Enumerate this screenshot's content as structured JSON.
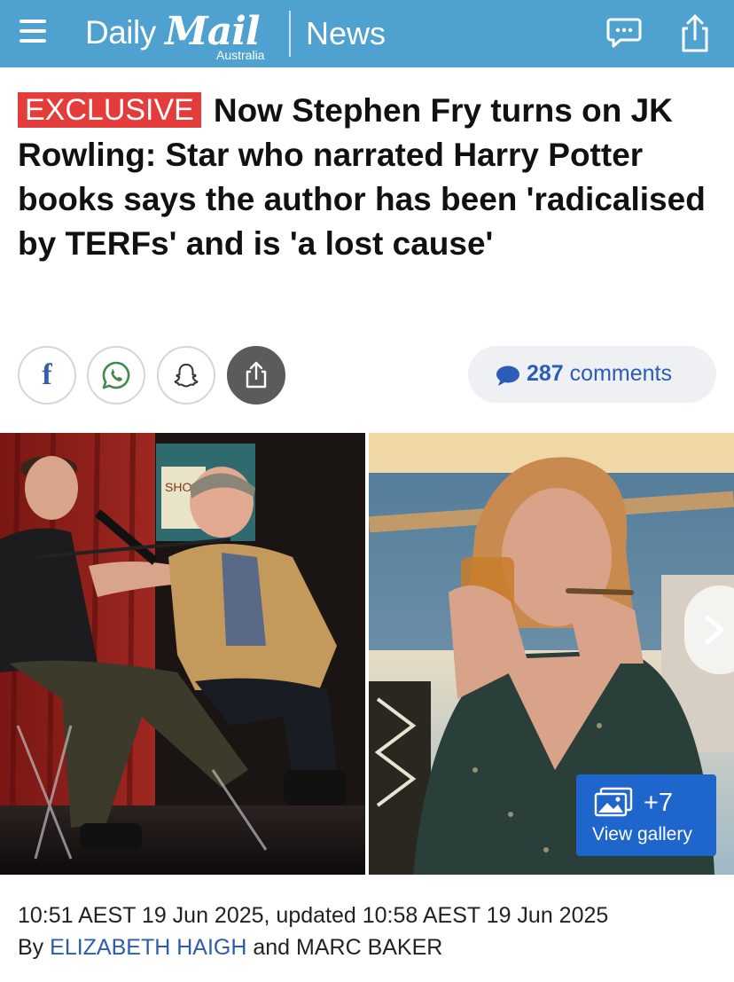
{
  "header": {
    "brand_daily": "Daily",
    "brand_mail": "Mail",
    "brand_sub": "Australia",
    "section": "News",
    "bg_color": "#4fa2cf"
  },
  "article": {
    "badge": "EXCLUSIVE",
    "headline": "Now Stephen Fry turns on JK Rowling: Star who narrated Harry Potter books says the author has been 'radicalised by TERFs' and is 'a lost cause'",
    "badge_color": "#e43b3b"
  },
  "social": {
    "facebook_label": "f",
    "comments_count": "287",
    "comments_word": "comments"
  },
  "gallery": {
    "count": "+7",
    "label": "View gallery"
  },
  "meta": {
    "published": "10:51 AEST 19 Jun 2025, updated 10:58 AEST 19 Jun 2025",
    "by": "By",
    "author1": "ELIZABETH HAIGH",
    "and": "and",
    "author2": "MARC BAKER"
  },
  "icons": [
    "menu-icon",
    "comment-icon",
    "share-icon",
    "facebook-icon",
    "whatsapp-icon",
    "snapchat-icon",
    "share-icon",
    "comment-bubble-icon",
    "chevron-right-icon",
    "gallery-icon"
  ]
}
